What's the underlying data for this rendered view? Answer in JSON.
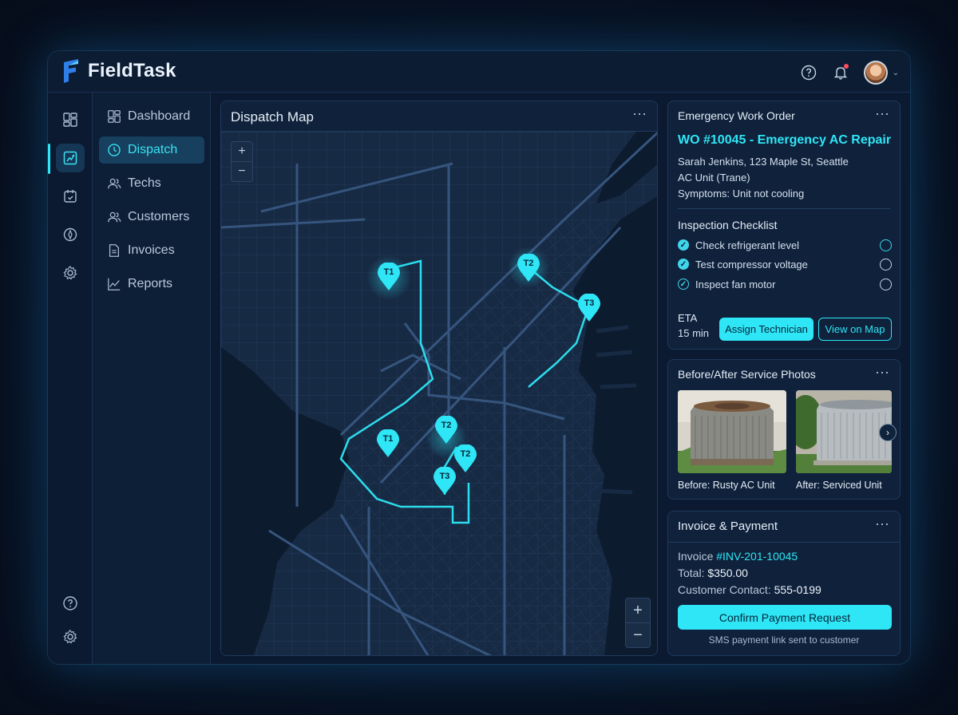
{
  "app": {
    "name": "FieldTask"
  },
  "header": {
    "help_icon": "help-circle-icon",
    "bell_icon": "bell-icon",
    "avatar": "user-avatar"
  },
  "nav": {
    "items": [
      {
        "label": "Dashboard",
        "icon": "dashboard-icon",
        "active": false
      },
      {
        "label": "Dispatch",
        "icon": "clock-icon",
        "active": true
      },
      {
        "label": "Techs",
        "icon": "users-icon",
        "active": false
      },
      {
        "label": "Customers",
        "icon": "customers-icon",
        "active": false
      },
      {
        "label": "Invoices",
        "icon": "document-icon",
        "active": false
      },
      {
        "label": "Reports",
        "icon": "chart-line-icon",
        "active": false
      }
    ]
  },
  "map": {
    "title": "Dispatch Map",
    "zoom_in": "+",
    "zoom_out": "−",
    "markers": [
      "T1",
      "T2",
      "T3",
      "T1",
      "T2",
      "T2",
      "T3"
    ]
  },
  "work_order": {
    "header": "Emergency Work Order",
    "title": "WO #10045 - Emergency AC Repair",
    "customer": "Sarah Jenkins, 123 Maple St, Seattle",
    "unit": "AC Unit (Trane)",
    "symptoms": "Symptoms: Unit not cooling",
    "checklist_title": "Inspection Checklist",
    "checklist": [
      {
        "label": "Check refrigerant level",
        "done": true
      },
      {
        "label": "Test compressor voltage",
        "done": true
      },
      {
        "label": "Inspect fan motor",
        "done": false
      }
    ],
    "eta_label": "ETA",
    "eta_value": "15 min",
    "assign_button": "Assign Technician",
    "map_button": "View on Map"
  },
  "photos": {
    "title": "Before/After Service Photos",
    "before_caption": "Before: Rusty AC Unit",
    "after_caption": "After: Serviced Unit"
  },
  "invoice": {
    "title": "Invoice & Payment",
    "invoice_label": "Invoice ",
    "invoice_id": "#INV-201-10045",
    "total_label": "Total: ",
    "total_value": "$350.00",
    "contact_label": "Customer Contact: ",
    "contact_value": "555-0199",
    "confirm_button": "Confirm Payment Request",
    "note": "SMS payment link sent to customer"
  },
  "colors": {
    "accent": "#2ee6f6",
    "background": "#0b1a30",
    "panel": "#0f213b"
  }
}
